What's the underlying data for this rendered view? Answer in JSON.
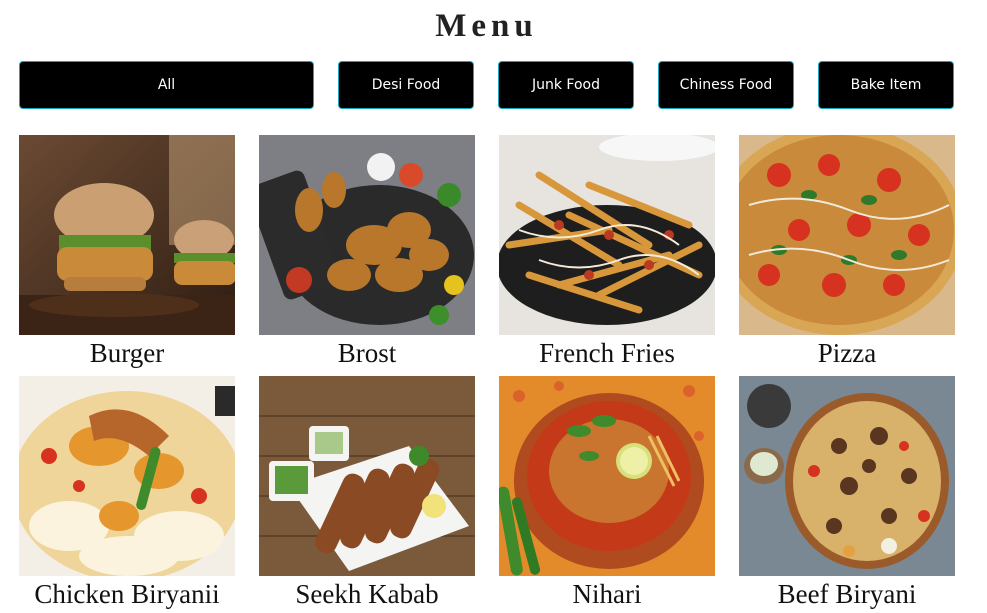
{
  "page": {
    "title": "Menu"
  },
  "filters": {
    "all": "All",
    "desi": "Desi Food",
    "junk": "Junk Food",
    "chiness": "Chiness Food",
    "bake": "Bake Item"
  },
  "items": [
    {
      "name": "Burger"
    },
    {
      "name": "Brost"
    },
    {
      "name": "French Fries"
    },
    {
      "name": "Pizza"
    },
    {
      "name": "Chicken Biryanii"
    },
    {
      "name": "Seekh Kabab"
    },
    {
      "name": "Nihari"
    },
    {
      "name": "Beef Biryani"
    }
  ],
  "colors": {
    "button_bg": "#000000",
    "button_border": "#1aa6c2",
    "button_text": "#ffffff",
    "title_text": "#222222"
  }
}
